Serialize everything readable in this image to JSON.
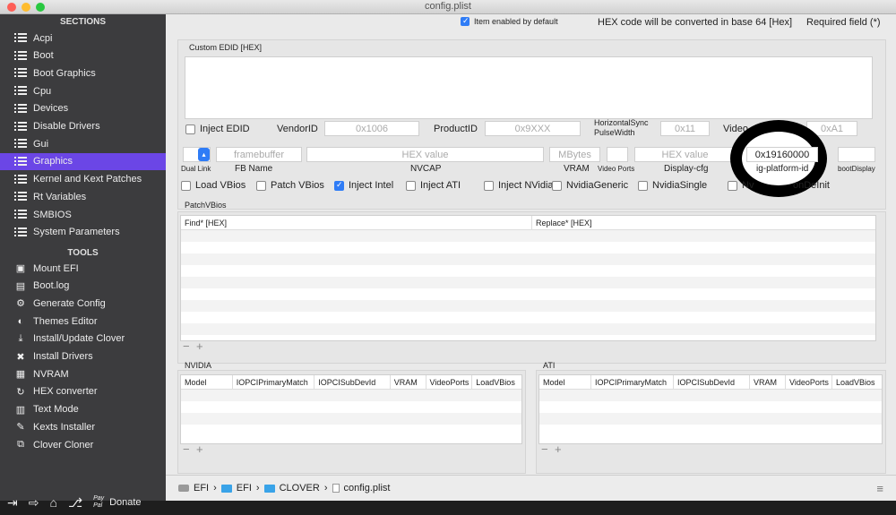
{
  "window": {
    "title": "config.plist"
  },
  "colors": {
    "accent": "#6b46e6",
    "sidebar": "#3c3c3e",
    "checkbox": "#2f7cf6"
  },
  "sidebar": {
    "sections_header": "SECTIONS",
    "sections": [
      {
        "label": "Acpi",
        "icon": "list-icon"
      },
      {
        "label": "Boot",
        "icon": "list-icon"
      },
      {
        "label": "Boot Graphics",
        "icon": "list-icon"
      },
      {
        "label": "Cpu",
        "icon": "list-icon"
      },
      {
        "label": "Devices",
        "icon": "list-icon"
      },
      {
        "label": "Disable Drivers",
        "icon": "list-icon"
      },
      {
        "label": "Gui",
        "icon": "list-icon"
      },
      {
        "label": "Graphics",
        "icon": "list-icon",
        "selected": true
      },
      {
        "label": "Kernel and Kext Patches",
        "icon": "list-icon"
      },
      {
        "label": "Rt Variables",
        "icon": "list-icon"
      },
      {
        "label": "SMBIOS",
        "icon": "list-icon"
      },
      {
        "label": "System Parameters",
        "icon": "list-icon"
      }
    ],
    "tools_header": "TOOLS",
    "tools": [
      {
        "label": "Mount EFI",
        "icon": "disk-icon"
      },
      {
        "label": "Boot.log",
        "icon": "log-icon"
      },
      {
        "label": "Generate Config",
        "icon": "gears-icon"
      },
      {
        "label": "Themes Editor",
        "icon": "palette-icon"
      },
      {
        "label": "Install/Update Clover",
        "icon": "download-icon"
      },
      {
        "label": "Install Drivers",
        "icon": "drivers-icon"
      },
      {
        "label": "NVRAM",
        "icon": "chip-icon"
      },
      {
        "label": "HEX converter",
        "icon": "refresh-icon"
      },
      {
        "label": "Text Mode",
        "icon": "text-icon"
      },
      {
        "label": "Kexts Installer",
        "icon": "kext-icon"
      },
      {
        "label": "Clover Cloner",
        "icon": "clone-icon"
      }
    ],
    "donate_label": "Donate",
    "paypal": "Pay Pal"
  },
  "legend": {
    "item_enabled": "Item enabled by default",
    "hex_note": "HEX code will be converted in base 64 [Hex]",
    "required": "Required field (*)"
  },
  "edid": {
    "label": "Custom EDID [HEX]",
    "inject_edid": "Inject EDID",
    "vendor_label": "VendorID",
    "vendor_ph": "0x1006",
    "product_label": "ProductID",
    "product_ph": "0x9XXX",
    "hsync_label1": "HorizontalSync",
    "hsync_label2": "PulseWidth",
    "hsync_ph": "0x11",
    "video_label": "Video",
    "video_ph": "0xA1"
  },
  "graphics": {
    "dual_link": "Dual Link",
    "dual_link_value": "",
    "fb_label": "FB Name",
    "fb_ph": "framebuffer",
    "nvcap_label": "NVCAP",
    "nvcap_ph": "HEX value",
    "vram_label": "VRAM",
    "vram_ph": "MBytes",
    "video_ports_label": "Video Ports",
    "display_cfg_label": "Display-cfg",
    "display_cfg_ph": "HEX value",
    "ig_label": "ig-platform-id",
    "ig_value": "0x19160000",
    "boot_display_label": "bootDisplay"
  },
  "checkboxes": [
    {
      "label": "Load VBios",
      "checked": false
    },
    {
      "label": "Patch VBios",
      "checked": false
    },
    {
      "label": "Inject Intel",
      "checked": true
    },
    {
      "label": "Inject ATI",
      "checked": false
    },
    {
      "label": "Inject NVidia",
      "checked": false
    },
    {
      "label": "NvidiaGeneric",
      "checked": false
    },
    {
      "label": "NvidiaSingle",
      "checked": false
    },
    {
      "label": "Nv",
      "checked": false
    },
    {
      "label": "onDeInit",
      "checked": false
    }
  ],
  "patch_vbios": {
    "label": "PatchVBios",
    "col_find": "Find* [HEX]",
    "col_replace": "Replace* [HEX]"
  },
  "nvidia": {
    "label": "NVIDIA",
    "cols": [
      "Model",
      "IOPCIPrimaryMatch",
      "IOPCISubDevId",
      "VRAM",
      "VideoPorts",
      "LoadVBios"
    ]
  },
  "ati": {
    "label": "ATI",
    "cols": [
      "Model",
      "IOPCIPrimaryMatch",
      "IOPCISubDevId",
      "VRAM",
      "VideoPorts",
      "LoadVBios"
    ]
  },
  "pathbar": {
    "items": [
      "EFI",
      "EFI",
      "CLOVER",
      "config.plist"
    ]
  }
}
